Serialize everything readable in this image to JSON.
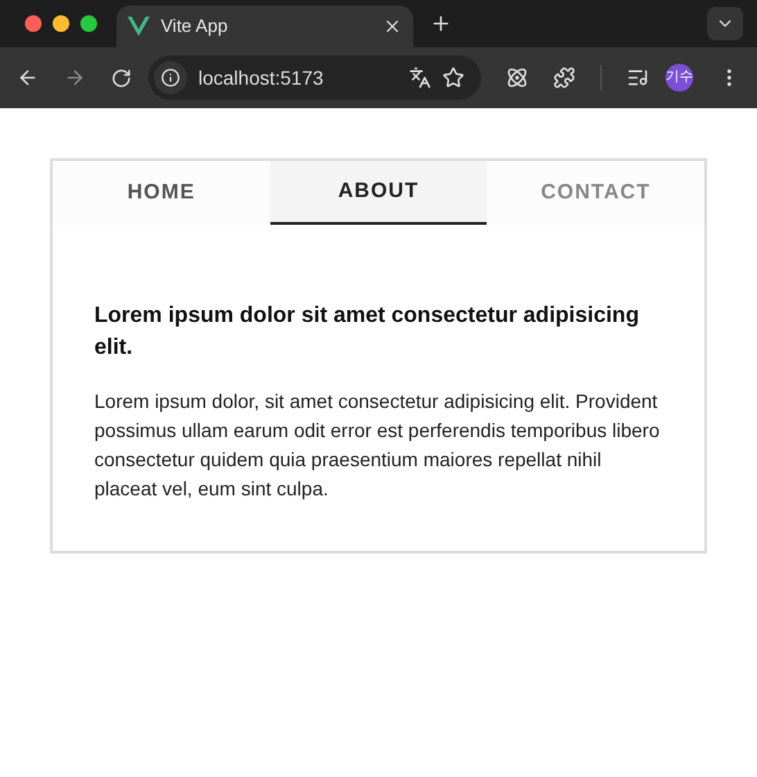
{
  "browser": {
    "tab_title": "Vite App",
    "url": "localhost:5173",
    "avatar": "기수"
  },
  "tabs": [
    {
      "label": "HOME",
      "selected": false,
      "color": "#555555"
    },
    {
      "label": "ABOUT",
      "selected": true,
      "color": "#222222"
    },
    {
      "label": "CONTACT",
      "selected": false,
      "color": "#888888"
    }
  ],
  "content": {
    "heading": "Lorem ipsum dolor sit amet consectetur adipisicing elit.",
    "body": "Lorem ipsum dolor, sit amet consectetur adipisicing elit. Provident possimus ullam earum odit error est perferendis temporibus libero consectetur quidem quia praesentium maiores repellat nihil placeat vel, eum sint culpa."
  }
}
